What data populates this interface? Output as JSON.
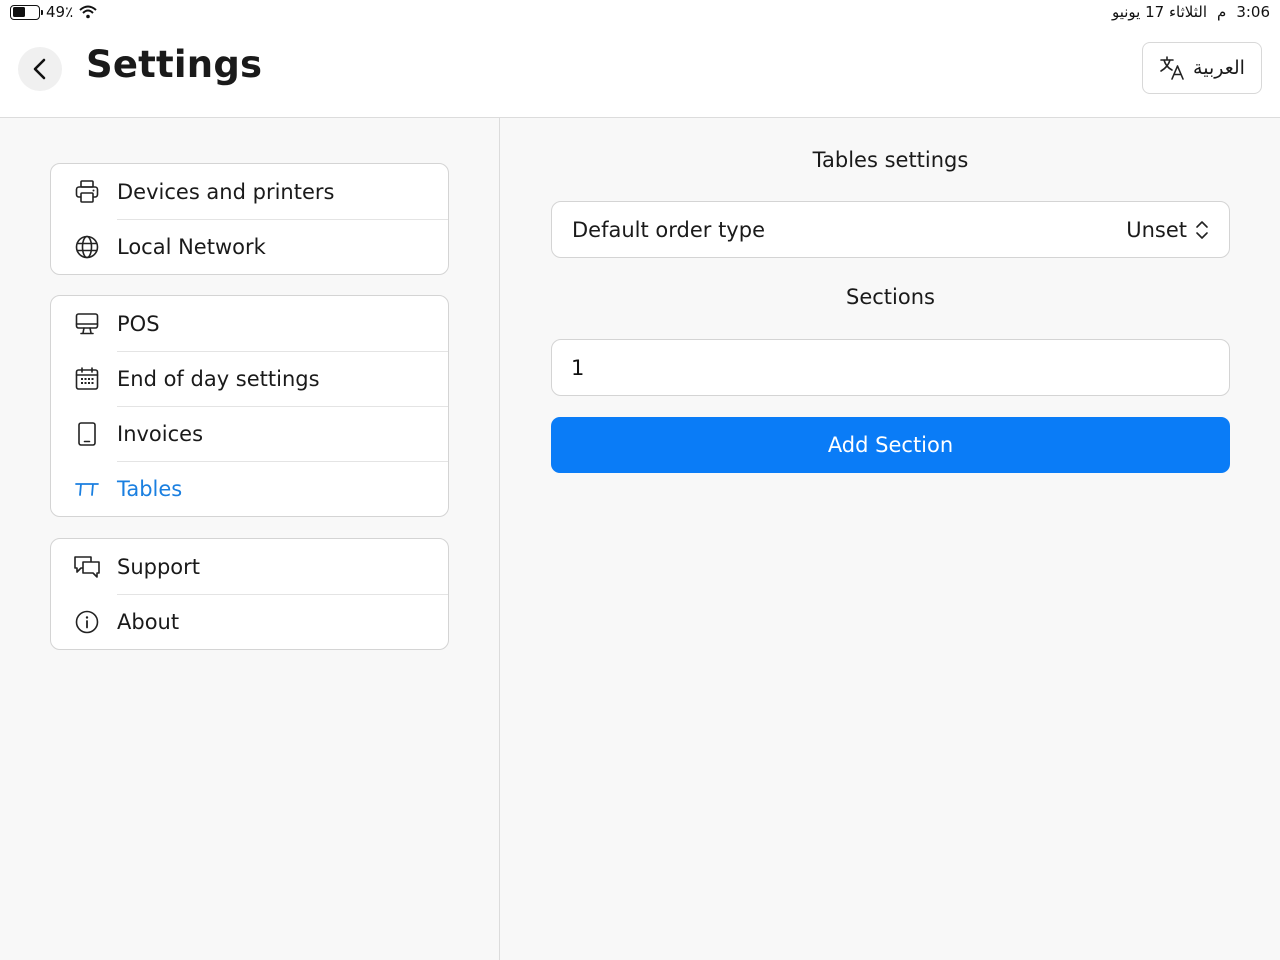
{
  "status_bar": {
    "battery_level": 0.49,
    "battery_text": "49٪",
    "time": "3:06",
    "period": "م",
    "date": "الثلاثاء 17 يونيو"
  },
  "header": {
    "title": "Settings",
    "language_label": "العربية"
  },
  "sidebar": {
    "groups": [
      {
        "items": [
          {
            "label": "Devices and printers",
            "icon": "printer-icon"
          },
          {
            "label": "Local Network",
            "icon": "globe-icon"
          }
        ]
      },
      {
        "items": [
          {
            "label": "POS",
            "icon": "monitor-icon"
          },
          {
            "label": "End of day settings",
            "icon": "calendar-icon"
          },
          {
            "label": "Invoices",
            "icon": "tablet-icon"
          },
          {
            "label": "Tables",
            "icon": "table-icon",
            "active": true
          }
        ]
      },
      {
        "items": [
          {
            "label": "Support",
            "icon": "chat-bubbles-icon"
          },
          {
            "label": "About",
            "icon": "info-icon"
          }
        ]
      }
    ]
  },
  "main": {
    "section_title": "Tables settings",
    "default_order_type": {
      "label": "Default order type",
      "value": "Unset"
    },
    "sections_title": "Sections",
    "sections_input_value": "1",
    "add_button_label": "Add Section"
  },
  "colors": {
    "accent": "#0a7cf7",
    "active_text": "#1a7fe0"
  }
}
